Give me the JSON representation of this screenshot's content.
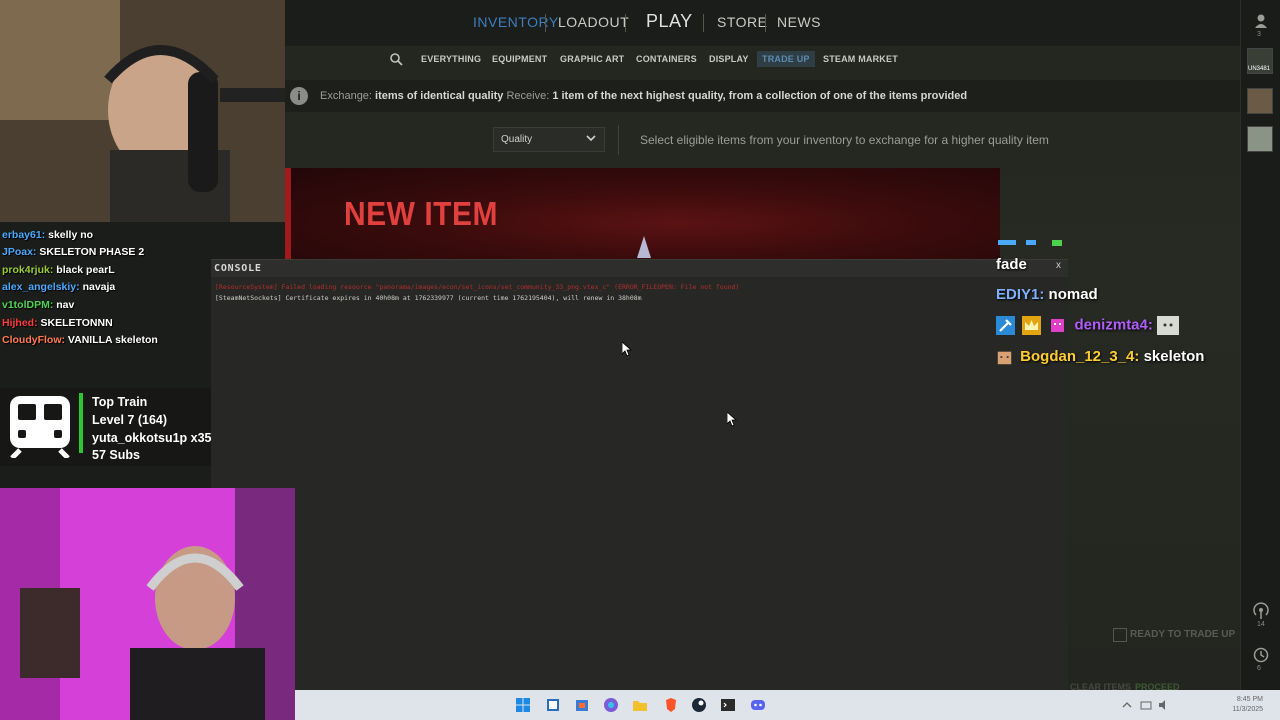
{
  "game": {
    "topnav": {
      "inventory": "INVENTORY",
      "loadout": "LOADOUT",
      "play": "PLAY",
      "store": "STORE",
      "news": "NEWS"
    },
    "subnav": {
      "everything": "EVERYTHING",
      "equipment": "EQUIPMENT",
      "graphic_art": "GRAPHIC ART",
      "containers": "CONTAINERS",
      "display": "DISPLAY",
      "trade_up": "TRADE UP",
      "steam_market": "STEAM MARKET"
    },
    "info": {
      "exchange_label": "Exchange:",
      "exchange_value": "items of identical quality",
      "receive_label": "Receive:",
      "receive_value": "1 item of the next highest quality, from a collection of one of the items provided"
    },
    "quality_select": "Quality",
    "select_hint": "Select eligible items from your inventory to exchange for a higher quality item",
    "new_item_title": "NEW ITEM",
    "ready_label": "READY TO TRADE UP",
    "bottom_left": "CLEAR ITEMS",
    "bottom_right": "PROCEED",
    "sidebar": {
      "friends_count": "3",
      "avatar_label": "UN3481",
      "signal_count": "14",
      "history_count": "6"
    }
  },
  "console": {
    "title": "CONSOLE",
    "close": "x",
    "error_line": "[ResourceSystem] Failed loading resource \"panorama/images/econ/set_icons/set_community_33_png.vtex_c\" (ERROR_FILEOPEN: File not found)",
    "info_line": "[SteamNetSockets] Certificate expires in 40h08m at 1762339977 (current time 1762195404), will renew in 38h08m"
  },
  "chat_right": {
    "header": "fade",
    "close": "x",
    "messages": [
      {
        "user": "EDIY1:",
        "text": "nomad",
        "color": "#7fb0ff"
      },
      {
        "user": "denizmta4:",
        "text": "",
        "color": "#b05cff"
      },
      {
        "user": "Bogdan_12_3_4:",
        "text": "skeleton",
        "color": "#ffcc33"
      }
    ]
  },
  "chat_left": {
    "messages": [
      {
        "user": "erbay61:",
        "text": "skelly no",
        "color": "#4aa8ff"
      },
      {
        "user": "JPoax:",
        "text": "SKELETON PHASE 2",
        "color": "#4aa8ff"
      },
      {
        "user": "prok4rjuk:",
        "text": "black pearL",
        "color": "#9acd32"
      },
      {
        "user": "alex_angelskiy:",
        "text": "navaja",
        "color": "#4aa8ff"
      },
      {
        "user": "v1tolDPM:",
        "text": "nav",
        "color": "#4fd14f"
      },
      {
        "user": "Hijhed:",
        "text": "SKELETONNN",
        "color": "#ff3b3b"
      },
      {
        "user": "CloudyFlow:",
        "text": "VANILLA skeleton",
        "color": "#ff7a50"
      }
    ]
  },
  "train": {
    "title": "Top Train",
    "level": "Level 7  (164)",
    "user": "yuta_okkotsu1p x35",
    "subs": "57 Subs"
  },
  "taskbar": {
    "time": "8:45 PM",
    "date": "11/3/2025"
  },
  "colors": {
    "accent_blue": "#3d7fbf",
    "new_item_red": "#e0403e",
    "train_green": "#2ec52e"
  }
}
